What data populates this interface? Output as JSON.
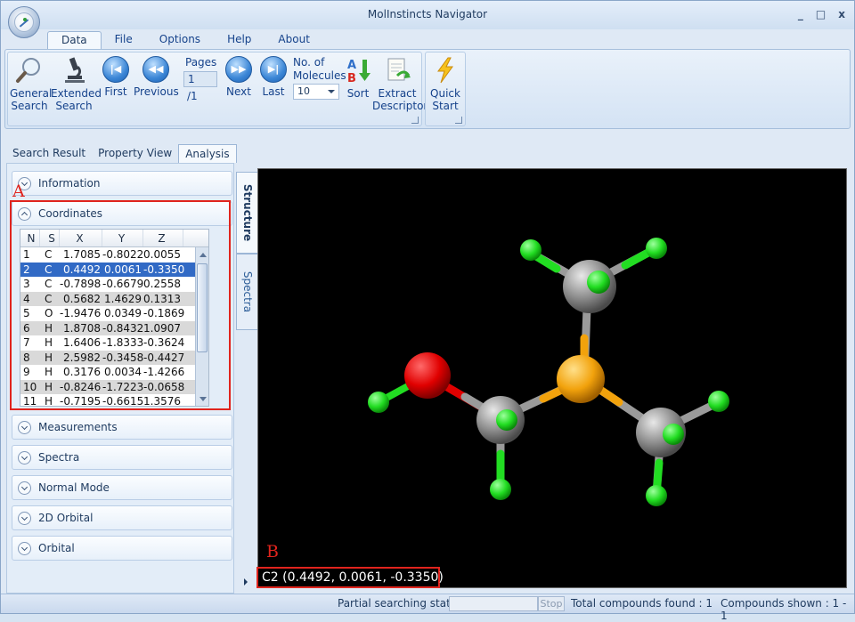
{
  "window": {
    "title": "MolInstincts Navigator",
    "min": "_",
    "restore": "□",
    "close": "x"
  },
  "menu": {
    "tabs": [
      "Data",
      "File",
      "Options",
      "Help",
      "About"
    ],
    "active": "Data"
  },
  "ribbon": {
    "general_search": [
      "General",
      "Search"
    ],
    "extended_search": [
      "Extended",
      "Search"
    ],
    "first": "First",
    "previous": "Previous",
    "pages_label": "Pages",
    "pages_current": "1",
    "pages_total": "/1",
    "next": "Next",
    "last": "Last",
    "molecules_label": [
      "No. of",
      "Molecules"
    ],
    "molecules_value": "10",
    "sort": "Sort",
    "extract_descriptor": [
      "Extract",
      "Descriptor"
    ],
    "quick_start": [
      "Quick",
      "Start"
    ]
  },
  "left_tabs": [
    "Search Result",
    "Property View",
    "Analysis"
  ],
  "accordion": {
    "information": "Information",
    "coordinates": "Coordinates",
    "measurements": "Measurements",
    "spectra": "Spectra",
    "normal_mode": "Normal Mode",
    "orbital_2d": "2D Orbital",
    "orbital": "Orbital"
  },
  "annotations": {
    "a": "A",
    "b": "B"
  },
  "coords_table": {
    "headers": [
      "N",
      "S",
      "X",
      "Y",
      "Z"
    ],
    "selected_row": 1,
    "rows": [
      [
        "1",
        "C",
        "1.7085",
        "-0.8022",
        "0.0055"
      ],
      [
        "2",
        "C",
        "0.4492",
        "0.0061",
        "-0.3350"
      ],
      [
        "3",
        "C",
        "-0.7898",
        "-0.6679",
        "0.2558"
      ],
      [
        "4",
        "C",
        "0.5682",
        "1.4629",
        "0.1313"
      ],
      [
        "5",
        "O",
        "-1.9476",
        "0.0349",
        "-0.1869"
      ],
      [
        "6",
        "H",
        "1.8708",
        "-0.8432",
        "1.0907"
      ],
      [
        "7",
        "H",
        "1.6406",
        "-1.8333",
        "-0.3624"
      ],
      [
        "8",
        "H",
        "2.5982",
        "-0.3458",
        "-0.4427"
      ],
      [
        "9",
        "H",
        "0.3176",
        "0.0034",
        "-1.4266"
      ],
      [
        "10",
        "H",
        "-0.8246",
        "-1.7223",
        "-0.0658"
      ],
      [
        "11",
        "H",
        "-0.7195",
        "-0.6615",
        "1.3576"
      ]
    ]
  },
  "viewer_tabs": {
    "structure": "Structure",
    "spectra": "Spectra"
  },
  "viewer": {
    "selection_readout": "C2 (0.4492, 0.0061, -0.3350)"
  },
  "status": {
    "partial_label": "Partial searching status :",
    "stop": "Stop",
    "total_found": "Total compounds found : 1",
    "shown": "Compounds shown : 1 - 1"
  },
  "colors": {
    "carbon": "#8c8c8c",
    "hydrogen": "#22dd22",
    "oxygen": "#e00000",
    "sulfur": "#f2a20c",
    "highlight": "#e0241d"
  }
}
